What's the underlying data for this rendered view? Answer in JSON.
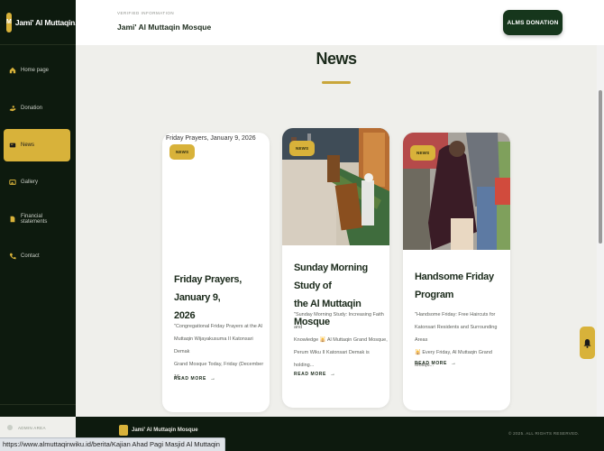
{
  "brand": {
    "logo_text": "M",
    "name": "Jami' Al Muttaqin..."
  },
  "sidebar": {
    "items": [
      {
        "label": "Home page",
        "icon": "home-icon",
        "active": false
      },
      {
        "label": "Donation",
        "icon": "donation-hand-icon",
        "active": false
      },
      {
        "label": "News",
        "icon": "newspaper-icon",
        "active": true
      },
      {
        "label": "Gallery",
        "icon": "gallery-icon",
        "active": false
      },
      {
        "label": "Financial statements",
        "icon": "document-icon",
        "active": false
      },
      {
        "label": "Contact",
        "icon": "phone-icon",
        "active": false
      }
    ],
    "admin_label": "ADMIN AREA"
  },
  "header": {
    "verified_label": "VERIFIED INFORMATION",
    "mosque_name": "Jami' Al Muttaqin Mosque",
    "alms_button": "ALMS DONATION"
  },
  "main": {
    "section_title": "News",
    "cards": [
      {
        "badge": "NEWS",
        "image_alt": "Friday Prayers, January 9, 2026",
        "title_lines": [
          "Friday Prayers, January 9,",
          "2026"
        ],
        "excerpt_lines": [
          "\"Congregational Friday Prayers at the Al",
          "Muttaqin Wijayakusuma II Katonsari Demak",
          "Grand Mosque Today, Friday (December 16..."
        ],
        "read_more": "READ MORE"
      },
      {
        "badge": "NEWS",
        "title_lines": [
          "Sunday Morning Study of",
          "the Al Muttaqin Mosque"
        ],
        "excerpt_lines": [
          "\"Sunday Morning Study: Increasing Faith and",
          "Knowledge 🕌 Al Muttaqin Grand Mosque,",
          "Perum Wiku II Katonsari Demak is holding..."
        ],
        "read_more": "READ MORE"
      },
      {
        "badge": "NEWS",
        "title_lines": [
          "Handsome Friday Program"
        ],
        "excerpt_lines": [
          "\"Handsome Friday: Free Haircuts for",
          "Katonsari Residents and Surrounding Areas",
          "🕌 Every Friday, Al Muttaqin Grand Mosqu..."
        ],
        "read_more": "READ MORE"
      }
    ]
  },
  "footer": {
    "name": "Jami' Al Muttaqin Mosque",
    "copyright": "© 2025. ALL RIGHTS RESERVED."
  },
  "status_bar": {
    "url": "https://www.almuttaqinwiku.id/berita/Kajian Ahad Pagi Masjid Al Muttaqin"
  },
  "colors": {
    "gold": "#d8b23a",
    "dark_green": "#0d1a0e",
    "button_green": "#16361c"
  }
}
